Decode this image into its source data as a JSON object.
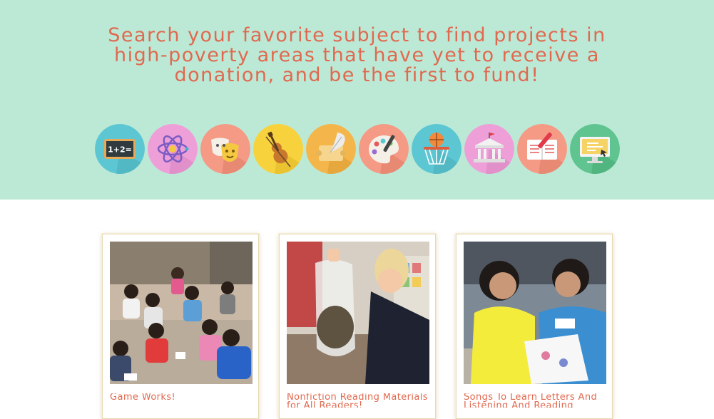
{
  "hero": {
    "headline": "Search your favorite subject to find projects in high-poverty areas that have yet to receive a donation, and be the first to fund!",
    "background": "#bce9d6",
    "accent": "#e0694f",
    "subjects": [
      {
        "icon": "math-chalkboard-icon",
        "bg": "#5cc7d3"
      },
      {
        "icon": "science-atom-icon",
        "bg": "#ee9fd8"
      },
      {
        "icon": "theater-masks-icon",
        "bg": "#f59a85"
      },
      {
        "icon": "music-violin-icon",
        "bg": "#f8d23c"
      },
      {
        "icon": "literacy-quill-scroll-icon",
        "bg": "#f4b64a"
      },
      {
        "icon": "art-palette-icon",
        "bg": "#f59a85"
      },
      {
        "icon": "sports-basketball-hoop-icon",
        "bg": "#5cc7d3"
      },
      {
        "icon": "history-civics-building-icon",
        "bg": "#ee9fd8"
      },
      {
        "icon": "special-needs-notebook-icon",
        "bg": "#f59a85"
      },
      {
        "icon": "technology-computer-icon",
        "bg": "#5fc48f"
      }
    ]
  },
  "projects": [
    {
      "title": "Game Works!",
      "photo": "students-reading-on-floor"
    },
    {
      "title": "Nonfiction Reading Materials for All Readers!",
      "photo": "teacher-holding-bag"
    },
    {
      "title": "Songs To Learn Letters And Listening And Reading",
      "photo": "two-girls-reading"
    }
  ]
}
